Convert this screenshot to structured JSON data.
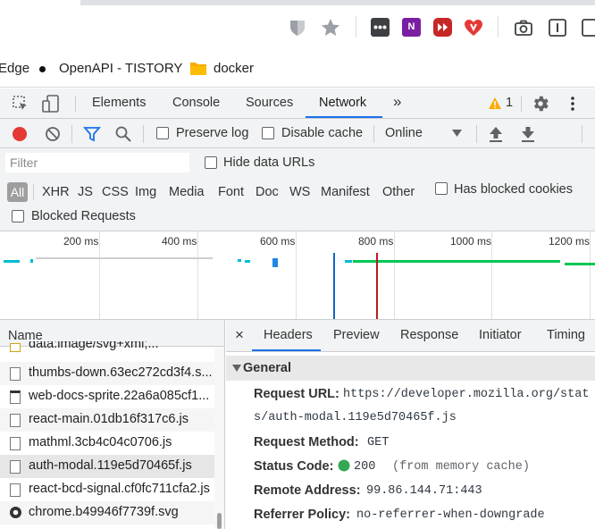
{
  "bookmarks": {
    "items": [
      {
        "label": "Edge"
      },
      {
        "label": "OpenAPI - TISTORY"
      },
      {
        "label": "docker"
      }
    ]
  },
  "devtools": {
    "tabs": [
      "Elements",
      "Console",
      "Sources",
      "Network"
    ],
    "active_tab": "Network",
    "warning_count": "1"
  },
  "network": {
    "toolbar": {
      "preserve_log": "Preserve log",
      "disable_cache": "Disable cache",
      "throttling": "Online"
    },
    "filter": {
      "placeholder": "Filter",
      "hide_data_urls": "Hide data URLs",
      "types": [
        "All",
        "XHR",
        "JS",
        "CSS",
        "Img",
        "Media",
        "Font",
        "Doc",
        "WS",
        "Manifest",
        "Other"
      ],
      "has_blocked_cookies": "Has blocked cookies",
      "blocked_requests": "Blocked Requests"
    },
    "timeline": {
      "ticks": [
        "200 ms",
        "400 ms",
        "600 ms",
        "800 ms",
        "1000 ms",
        "1200 ms"
      ]
    },
    "requests": {
      "header": "Name",
      "rows": [
        {
          "name": "data:image/svg+xml;..."
        },
        {
          "name": "thumbs-down.63ec272cd3f4.s..."
        },
        {
          "name": "web-docs-sprite.22a6a085cf1..."
        },
        {
          "name": "react-main.01db16f317c6.js"
        },
        {
          "name": "mathml.3cb4c04c0706.js"
        },
        {
          "name": "auth-modal.119e5d70465f.js"
        },
        {
          "name": "react-bcd-signal.cf0fc711cfa2.js"
        },
        {
          "name": "chrome.b49946f7739f.svg"
        }
      ]
    },
    "details": {
      "close": "×",
      "tabs": [
        "Headers",
        "Preview",
        "Response",
        "Initiator",
        "Timing"
      ],
      "section": "General",
      "request_url_key": "Request URL:",
      "request_url_value_1": "https://developer.mozilla.org/stat",
      "request_url_value_2": "s/auth-modal.119e5d70465f.js",
      "request_method_key": "Request Method:",
      "request_method_value": "GET",
      "status_code_key": "Status Code:",
      "status_code_value": "200",
      "status_code_note": "(from memory cache)",
      "remote_address_key": "Remote Address:",
      "remote_address_value": "99.86.144.71:443",
      "referrer_policy_key": "Referrer Policy:",
      "referrer_policy_value": "no-referrer-when-downgrade"
    }
  },
  "colors": {
    "accent": "#1a73e8",
    "record": "#e53935",
    "status_ok": "#34a853",
    "timeline_green": "#00c853",
    "timeline_teal": "#00bcd4",
    "dom_line": "#1565c0",
    "load_line": "#b71c1c"
  },
  "icons": {
    "extensions": [
      "shield-icon",
      "star-icon",
      "dots-icon",
      "onenote-icon",
      "playlist-icon",
      "heart-icon",
      "camera-icon",
      "reader-icon"
    ],
    "devtools": [
      "inspect-icon",
      "device-icon",
      "more-tabs-icon",
      "warning-icon",
      "gear-icon",
      "kebab-icon"
    ],
    "network": [
      "record-icon",
      "clear-icon",
      "filter-icon",
      "search-icon",
      "throttle-dropdown-icon",
      "upload-icon",
      "download-icon"
    ]
  }
}
